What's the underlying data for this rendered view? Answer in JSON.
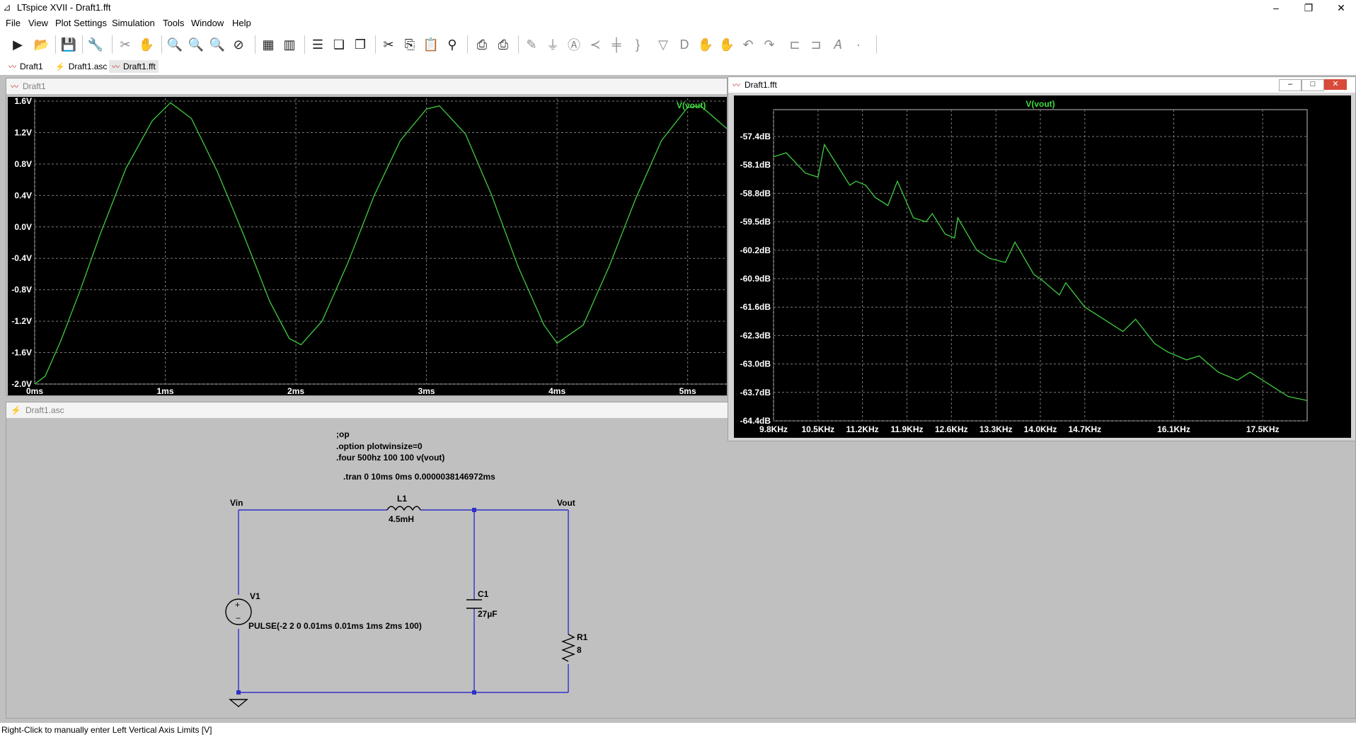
{
  "app": {
    "title": "LTspice XVII - Draft1.fft"
  },
  "menu": [
    "File",
    "View",
    "Plot Settings",
    "Simulation",
    "Tools",
    "Window",
    "Help"
  ],
  "tabs": [
    {
      "label": "Draft1",
      "icon": "waveform-icon"
    },
    {
      "label": "Draft1.asc",
      "icon": "schematic-icon"
    },
    {
      "label": "Draft1.fft",
      "icon": "waveform-icon"
    }
  ],
  "transient_window": {
    "title": "Draft1",
    "trace_label": "V(vout)",
    "y_ticks": [
      "1.6V",
      "1.2V",
      "0.8V",
      "0.4V",
      "0.0V",
      "-0.4V",
      "-0.8V",
      "-1.2V",
      "-1.6V",
      "-2.0V"
    ],
    "x_ticks": [
      "0ms",
      "1ms",
      "2ms",
      "3ms",
      "4ms",
      "5ms"
    ]
  },
  "fft_window": {
    "title": "Draft1.fft",
    "trace_label": "V(vout)",
    "y_ticks": [
      "-57.4dB",
      "-58.1dB",
      "-58.8dB",
      "-59.5dB",
      "-60.2dB",
      "-60.9dB",
      "-61.6dB",
      "-62.3dB",
      "-63.0dB",
      "-63.7dB",
      "-64.4dB"
    ],
    "x_ticks": [
      "9.8KHz",
      "10.5KHz",
      "11.2KHz",
      "11.9KHz",
      "12.6KHz",
      "13.3KHz",
      "14.0KHz",
      "14.7KHz",
      "16.1KHz",
      "17.5KHz"
    ]
  },
  "schematic_window": {
    "title": "Draft1.asc",
    "directives": [
      ";op",
      ".option plotwinsize=0",
      ".four 500hz 100 100 v(vout)",
      ".tran 0 10ms 0ms 0.0000038146972ms"
    ],
    "nets": {
      "vin": "Vin",
      "vout": "Vout"
    },
    "components": {
      "l1": {
        "name": "L1",
        "value": "4.5mH"
      },
      "c1": {
        "name": "C1",
        "value": "27µF"
      },
      "r1": {
        "name": "R1",
        "value": "8"
      },
      "v1": {
        "name": "V1",
        "value": "PULSE(-2 2 0 0.01ms 0.01ms 1ms 2ms 100)"
      }
    }
  },
  "status": {
    "text": "Right-Click to manually enter Left Vertical Axis Limits [V]"
  },
  "chart_data": [
    {
      "type": "line",
      "title": "",
      "series": [
        {
          "name": "V(vout)"
        }
      ],
      "xlabel": "",
      "ylabel": "",
      "xlim": [
        0,
        5.3
      ],
      "ylim": [
        -2.0,
        1.6
      ],
      "x_ticks": [
        0,
        1,
        2,
        3,
        4,
        5
      ],
      "note_units": "x in ms, y in V",
      "x": [
        0,
        0.08,
        0.2,
        0.35,
        0.5,
        0.7,
        0.9,
        1.04,
        1.2,
        1.4,
        1.6,
        1.8,
        1.95,
        2.04,
        2.2,
        2.4,
        2.6,
        2.8,
        3.0,
        3.1,
        3.3,
        3.5,
        3.7,
        3.9,
        4.0,
        4.2,
        4.4,
        4.6,
        4.8,
        5.0,
        5.1,
        5.3
      ],
      "y": [
        -2.0,
        -1.9,
        -1.45,
        -0.8,
        -0.1,
        0.75,
        1.35,
        1.58,
        1.38,
        0.7,
        -0.1,
        -0.95,
        -1.42,
        -1.5,
        -1.2,
        -0.45,
        0.4,
        1.1,
        1.5,
        1.54,
        1.18,
        0.4,
        -0.5,
        -1.25,
        -1.48,
        -1.25,
        -0.5,
        0.35,
        1.1,
        1.52,
        1.54,
        1.25
      ]
    },
    {
      "type": "line",
      "title": "",
      "series": [
        {
          "name": "V(vout)"
        }
      ],
      "xlabel": "",
      "ylabel": "",
      "xlim": [
        9.8,
        18.2
      ],
      "ylim": [
        -64.4,
        -56.9
      ],
      "x_ticks": [
        9.8,
        10.5,
        11.2,
        11.9,
        12.6,
        13.3,
        14.0,
        14.7,
        16.1,
        17.5
      ],
      "note_units": "x in KHz, y in dB",
      "x": [
        9.8,
        10.0,
        10.3,
        10.5,
        10.6,
        11.0,
        11.1,
        11.25,
        11.4,
        11.6,
        11.75,
        12.0,
        12.2,
        12.3,
        12.5,
        12.65,
        12.7,
        13.0,
        13.2,
        13.45,
        13.6,
        13.9,
        14.0,
        14.3,
        14.4,
        14.7,
        15.0,
        15.3,
        15.5,
        15.8,
        16.0,
        16.3,
        16.5,
        16.8,
        17.1,
        17.3,
        17.7,
        17.9,
        18.2
      ],
      "y": [
        -57.9,
        -57.8,
        -58.3,
        -58.4,
        -57.6,
        -58.6,
        -58.5,
        -58.6,
        -58.9,
        -59.1,
        -58.5,
        -59.4,
        -59.5,
        -59.3,
        -59.8,
        -59.9,
        -59.4,
        -60.2,
        -60.4,
        -60.5,
        -60.0,
        -60.8,
        -60.9,
        -61.3,
        -61.0,
        -61.6,
        -61.9,
        -62.2,
        -61.9,
        -62.5,
        -62.7,
        -62.9,
        -62.8,
        -63.2,
        -63.4,
        -63.2,
        -63.6,
        -63.8,
        -63.9
      ]
    }
  ]
}
